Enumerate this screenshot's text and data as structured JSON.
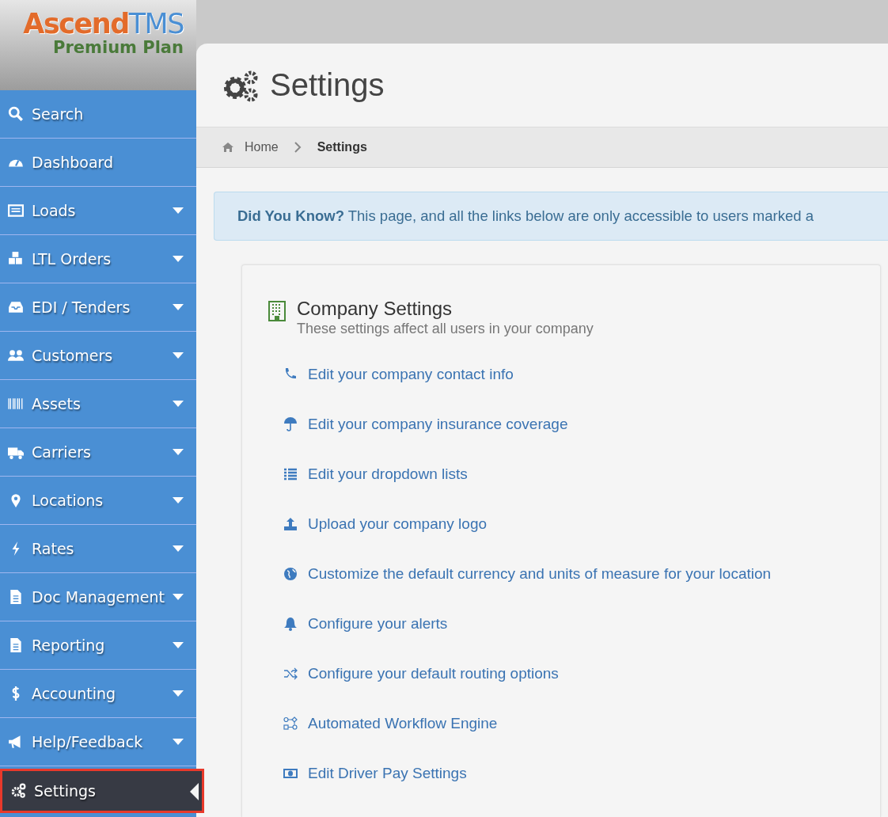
{
  "logo": {
    "brand_first": "Ascend",
    "brand_second": "TMS",
    "plan": "Premium Plan"
  },
  "sidebar": {
    "items": [
      {
        "label": "Search",
        "expandable": false,
        "selected": false
      },
      {
        "label": "Dashboard",
        "expandable": false,
        "selected": false
      },
      {
        "label": "Loads",
        "expandable": true,
        "selected": false
      },
      {
        "label": "LTL Orders",
        "expandable": true,
        "selected": false
      },
      {
        "label": "EDI / Tenders",
        "expandable": true,
        "selected": false
      },
      {
        "label": "Customers",
        "expandable": true,
        "selected": false
      },
      {
        "label": "Assets",
        "expandable": true,
        "selected": false
      },
      {
        "label": "Carriers",
        "expandable": true,
        "selected": false
      },
      {
        "label": "Locations",
        "expandable": true,
        "selected": false
      },
      {
        "label": "Rates",
        "expandable": true,
        "selected": false
      },
      {
        "label": "Doc Management",
        "expandable": true,
        "selected": false
      },
      {
        "label": "Reporting",
        "expandable": true,
        "selected": false
      },
      {
        "label": "Accounting",
        "expandable": true,
        "selected": false
      },
      {
        "label": "Help/Feedback",
        "expandable": true,
        "selected": false
      },
      {
        "label": "Settings",
        "expandable": false,
        "selected": true
      }
    ]
  },
  "page": {
    "title": "Settings",
    "breadcrumb": [
      {
        "label": "Home",
        "current": false
      },
      {
        "label": "Settings",
        "current": true
      }
    ],
    "alert": {
      "lead": "Did You Know?",
      "text": "This page, and all the links below are only accessible to users marked a"
    },
    "card": {
      "title": "Company Settings",
      "subtitle": "These settings affect all users in your company",
      "links": [
        {
          "label": "Edit your company contact info"
        },
        {
          "label": "Edit your company insurance coverage"
        },
        {
          "label": "Edit your dropdown lists"
        },
        {
          "label": "Upload your company logo"
        },
        {
          "label": "Customize the default currency and units of measure for your location"
        },
        {
          "label": "Configure your alerts"
        },
        {
          "label": "Configure your default routing options"
        },
        {
          "label": "Automated Workflow Engine"
        },
        {
          "label": "Edit Driver Pay Settings"
        }
      ]
    }
  }
}
